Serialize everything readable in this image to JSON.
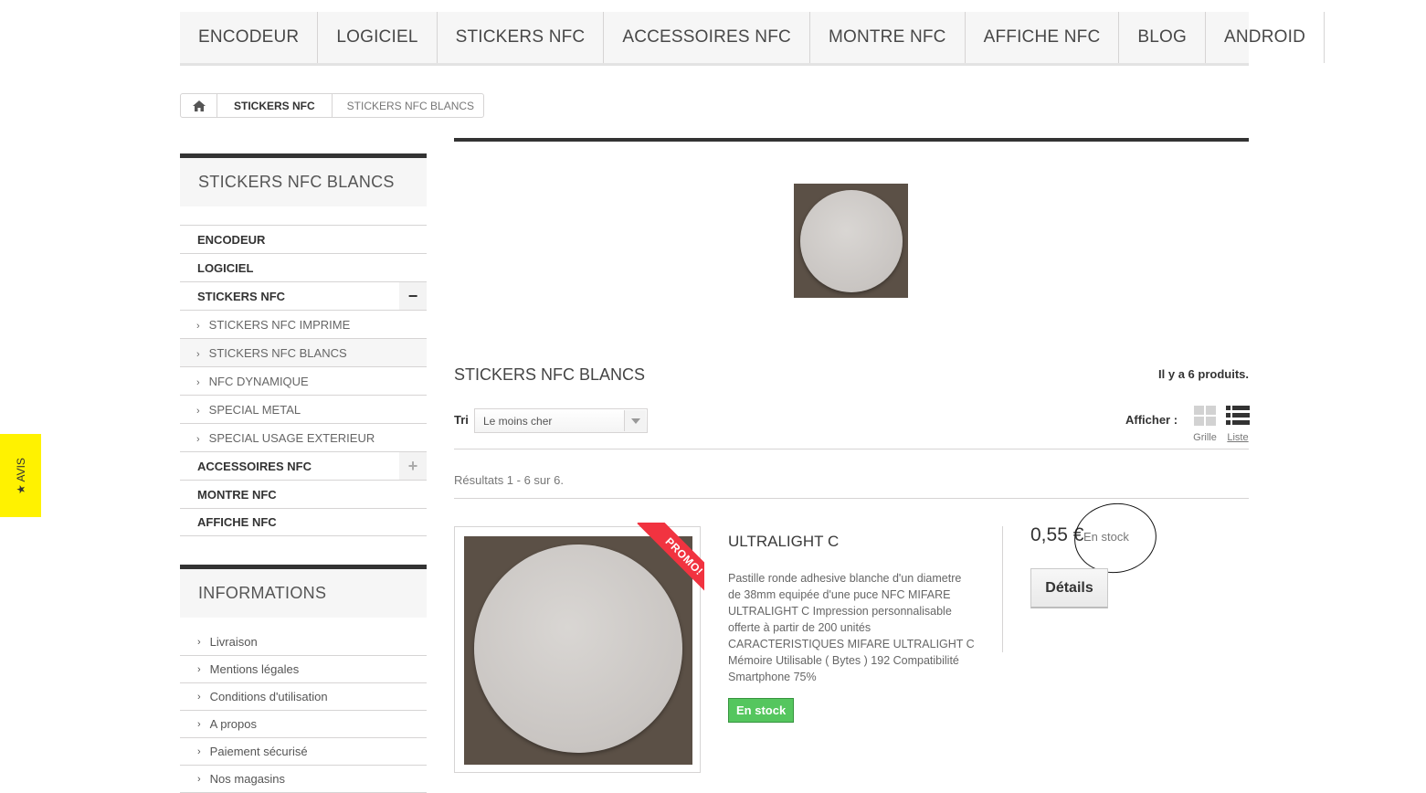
{
  "nav": {
    "items": [
      "ENCODEUR",
      "LOGICIEL",
      "STICKERS NFC",
      "ACCESSOIRES NFC",
      "MONTRE NFC",
      "AFFICHE NFC",
      "BLOG",
      "ANDROID"
    ]
  },
  "breadcrumb": {
    "home_icon": "home-icon",
    "category": "STICKERS NFC",
    "current": "STICKERS NFC BLANCS"
  },
  "sidebar": {
    "title": "STICKERS NFC BLANCS",
    "items": [
      {
        "label": "ENCODEUR",
        "level": "top"
      },
      {
        "label": "LOGICIEL",
        "level": "top"
      },
      {
        "label": "STICKERS NFC",
        "level": "top",
        "toggle": "−"
      },
      {
        "label": "STICKERS NFC IMPRIME",
        "level": "sub"
      },
      {
        "label": "STICKERS NFC BLANCS",
        "level": "sub"
      },
      {
        "label": "NFC DYNAMIQUE",
        "level": "sub"
      },
      {
        "label": "SPECIAL METAL",
        "level": "sub"
      },
      {
        "label": "SPECIAL USAGE EXTERIEUR",
        "level": "sub"
      },
      {
        "label": "ACCESSOIRES NFC",
        "level": "top",
        "toggle": "+"
      },
      {
        "label": "MONTRE NFC",
        "level": "top"
      },
      {
        "label": "AFFICHE NFC",
        "level": "top"
      }
    ],
    "info_title": "INFORMATIONS",
    "info_items": [
      "Livraison",
      "Mentions légales",
      "Conditions d'utilisation",
      "A propos",
      "Paiement sécurisé",
      "Nos magasins"
    ]
  },
  "category": {
    "title": "STICKERS NFC BLANCS",
    "count": "Il y a 6 produits.",
    "sort_label": "Tri",
    "sort_value": "Le moins cher",
    "view_label": "Afficher :",
    "view_grid": "Grille",
    "view_list": "Liste",
    "results": "Résultats 1 - 6 sur 6."
  },
  "product": {
    "badge": "PROMO!",
    "name": "ULTRALIGHT C",
    "description": "Pastille ronde adhesive blanche d'un diametre de 38mm equipée d'une puce NFC MIFARE ULTRALIGHT C Impression personnalisable offerte à partir de 200 unités CARACTERISTIQUES MIFARE ULTRALIGHT C Mémoire Utilisable ( Bytes ) 192 Compatibilité Smartphone 75%",
    "stock_badge": "En stock",
    "price": "0,55 €",
    "stock_note": "En stock",
    "details_label": "Détails"
  },
  "avis": {
    "label": "★ AVIS"
  },
  "colors": {
    "promo": "#f13340",
    "stock": "#55c65e",
    "avis": "#fff200"
  }
}
